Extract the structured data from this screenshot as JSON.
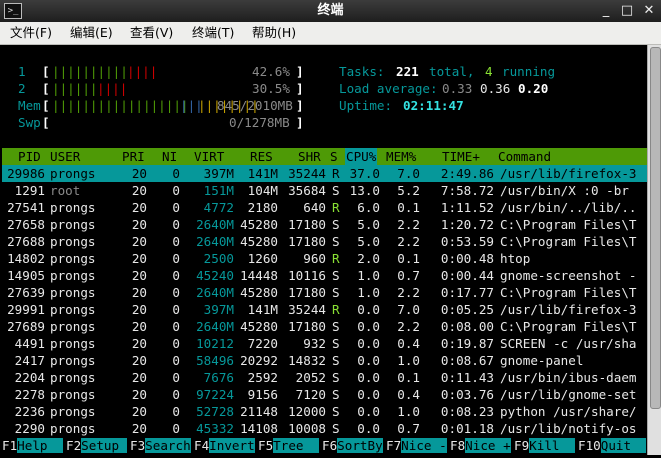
{
  "window": {
    "title": "终端"
  },
  "menubar": [
    {
      "label": "文件(F)"
    },
    {
      "label": "编辑(E)"
    },
    {
      "label": "查看(V)"
    },
    {
      "label": "终端(T)"
    },
    {
      "label": "帮助(H)"
    }
  ],
  "meters": {
    "cpu1": {
      "label": "1",
      "bar_green": "||||||||||",
      "bar_red": "||||",
      "value": "42.6%"
    },
    "cpu2": {
      "label": "2",
      "bar_green": "||||||",
      "bar_red": "||||",
      "value": "30.5%"
    },
    "mem": {
      "label": "Mem",
      "bar_green": "||||||||||||||||||",
      "bar_blue": "|||",
      "bar_yellow": "||||||||",
      "value": "845/2010MB"
    },
    "swp": {
      "label": "Swp",
      "value": "0/1278MB"
    }
  },
  "summary": {
    "tasks_label": "Tasks:",
    "tasks_total": "221",
    "tasks_total_label": "total,",
    "tasks_running": "4",
    "tasks_running_label": "running",
    "load_label": "Load average:",
    "load1": "0.33",
    "load5": "0.36",
    "load15": "0.20",
    "uptime_label": "Uptime:",
    "uptime": "02:11:47"
  },
  "table": {
    "headers": [
      "PID",
      "USER",
      "PRI",
      "NI",
      "VIRT",
      "RES",
      "SHR",
      "S",
      "CPU%",
      "MEM%",
      "TIME+",
      "Command"
    ],
    "rows": [
      {
        "pid": "29986",
        "user": "prongs",
        "pri": "20",
        "ni": "0",
        "virt": "397M",
        "res": "141M",
        "shr": "35244",
        "s": "R",
        "cpu": "37.0",
        "mem": "7.0",
        "time": "2:49.86",
        "cmd": "/usr/lib/firefox-3"
      },
      {
        "pid": "1291",
        "user": "root",
        "pri": "20",
        "ni": "0",
        "virt": "151M",
        "res": "104M",
        "shr": "35684",
        "s": "S",
        "cpu": "13.0",
        "mem": "5.2",
        "time": "7:58.72",
        "cmd": "/usr/bin/X :0 -br"
      },
      {
        "pid": "27541",
        "user": "prongs",
        "pri": "20",
        "ni": "0",
        "virt": "4772",
        "res": "2180",
        "shr": "640",
        "s": "R",
        "cpu": "6.0",
        "mem": "0.1",
        "time": "1:11.52",
        "cmd": "/usr/bin/../lib/.."
      },
      {
        "pid": "27658",
        "user": "prongs",
        "pri": "20",
        "ni": "0",
        "virt": "2640M",
        "res": "45280",
        "shr": "17180",
        "s": "S",
        "cpu": "5.0",
        "mem": "2.2",
        "time": "1:20.72",
        "cmd": "C:\\Program Files\\T"
      },
      {
        "pid": "27688",
        "user": "prongs",
        "pri": "20",
        "ni": "0",
        "virt": "2640M",
        "res": "45280",
        "shr": "17180",
        "s": "S",
        "cpu": "5.0",
        "mem": "2.2",
        "time": "0:53.59",
        "cmd": "C:\\Program Files\\T"
      },
      {
        "pid": "14802",
        "user": "prongs",
        "pri": "20",
        "ni": "0",
        "virt": "2500",
        "res": "1260",
        "shr": "960",
        "s": "R",
        "cpu": "2.0",
        "mem": "0.1",
        "time": "0:00.48",
        "cmd": "htop"
      },
      {
        "pid": "14905",
        "user": "prongs",
        "pri": "20",
        "ni": "0",
        "virt": "45240",
        "res": "14448",
        "shr": "10116",
        "s": "S",
        "cpu": "1.0",
        "mem": "0.7",
        "time": "0:00.44",
        "cmd": "gnome-screenshot -"
      },
      {
        "pid": "27639",
        "user": "prongs",
        "pri": "20",
        "ni": "0",
        "virt": "2640M",
        "res": "45280",
        "shr": "17180",
        "s": "S",
        "cpu": "1.0",
        "mem": "2.2",
        "time": "0:17.77",
        "cmd": "C:\\Program Files\\T"
      },
      {
        "pid": "29991",
        "user": "prongs",
        "pri": "20",
        "ni": "0",
        "virt": "397M",
        "res": "141M",
        "shr": "35244",
        "s": "R",
        "cpu": "0.0",
        "mem": "7.0",
        "time": "0:05.25",
        "cmd": "/usr/lib/firefox-3"
      },
      {
        "pid": "27689",
        "user": "prongs",
        "pri": "20",
        "ni": "0",
        "virt": "2640M",
        "res": "45280",
        "shr": "17180",
        "s": "S",
        "cpu": "0.0",
        "mem": "2.2",
        "time": "0:08.00",
        "cmd": "C:\\Program Files\\T"
      },
      {
        "pid": "4491",
        "user": "prongs",
        "pri": "20",
        "ni": "0",
        "virt": "10212",
        "res": "7220",
        "shr": "932",
        "s": "S",
        "cpu": "0.0",
        "mem": "0.4",
        "time": "0:19.87",
        "cmd": "SCREEN -c /usr/sha"
      },
      {
        "pid": "2417",
        "user": "prongs",
        "pri": "20",
        "ni": "0",
        "virt": "58496",
        "res": "20292",
        "shr": "14832",
        "s": "S",
        "cpu": "0.0",
        "mem": "1.0",
        "time": "0:08.67",
        "cmd": "gnome-panel"
      },
      {
        "pid": "2204",
        "user": "prongs",
        "pri": "20",
        "ni": "0",
        "virt": "7676",
        "res": "2592",
        "shr": "2052",
        "s": "S",
        "cpu": "0.0",
        "mem": "0.1",
        "time": "0:11.43",
        "cmd": "/usr/bin/ibus-daem"
      },
      {
        "pid": "2278",
        "user": "prongs",
        "pri": "20",
        "ni": "0",
        "virt": "97224",
        "res": "9156",
        "shr": "7120",
        "s": "S",
        "cpu": "0.0",
        "mem": "0.4",
        "time": "0:03.76",
        "cmd": "/usr/lib/gnome-set"
      },
      {
        "pid": "2236",
        "user": "prongs",
        "pri": "20",
        "ni": "0",
        "virt": "52728",
        "res": "21148",
        "shr": "12000",
        "s": "S",
        "cpu": "0.0",
        "mem": "1.0",
        "time": "0:08.23",
        "cmd": "python /usr/share/"
      },
      {
        "pid": "2290",
        "user": "prongs",
        "pri": "20",
        "ni": "0",
        "virt": "45332",
        "res": "14108",
        "shr": "10008",
        "s": "S",
        "cpu": "0.0",
        "mem": "0.7",
        "time": "0:01.18",
        "cmd": "/usr/lib/notify-os"
      }
    ]
  },
  "footer": [
    {
      "key": "F1",
      "label": "Help  "
    },
    {
      "key": "F2",
      "label": "Setup "
    },
    {
      "key": "F3",
      "label": "Search"
    },
    {
      "key": "F4",
      "label": "Invert"
    },
    {
      "key": "F5",
      "label": "Tree  "
    },
    {
      "key": "F6",
      "label": "SortBy"
    },
    {
      "key": "F7",
      "label": "Nice -"
    },
    {
      "key": "F8",
      "label": "Nice +"
    },
    {
      "key": "F9",
      "label": "Kill  "
    },
    {
      "key": "F10",
      "label": "Quit  "
    }
  ],
  "colors": {
    "header_bg": "#4e9a06",
    "selected_bg": "#06989a",
    "cyan": "#06989a",
    "bright_cyan": "#34e2e2"
  }
}
